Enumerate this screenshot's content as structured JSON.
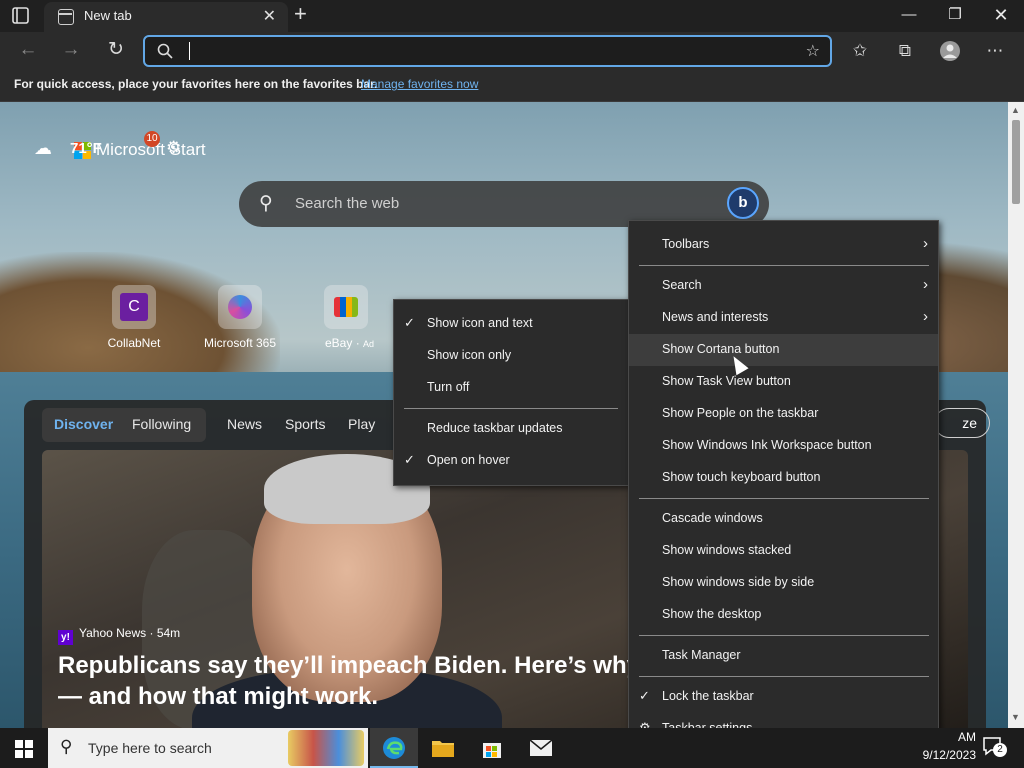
{
  "browser": {
    "tab_title": "New tab",
    "address_value": "",
    "favorites_message": "For quick access, place your favorites here on the favorites bar.",
    "favorites_link": "Manage favorites now"
  },
  "ntp": {
    "temperature": "71°F",
    "brand": "Microsoft Start",
    "notification_count": "10",
    "search_placeholder": "Search the web",
    "quick_links": [
      {
        "label": "CollabNet",
        "icon": "C"
      },
      {
        "label": "Microsoft 365",
        "icon": "m365-icon"
      },
      {
        "label": "eBay",
        "icon": "ebay-icon",
        "ad": "Ad"
      }
    ],
    "feed_tabs": [
      "Discover",
      "Following",
      "News",
      "Sports",
      "Play"
    ],
    "personalize_label": "ze",
    "article": {
      "source": "Yahoo News · 54m",
      "source_logo": "y!",
      "headline": "Republicans say they’ll impeach Biden. Here’s why — and how that might work."
    }
  },
  "taskbar_menu": {
    "items": [
      {
        "label": "Toolbars",
        "submenu": true
      },
      {
        "label": "Search",
        "submenu": true
      },
      {
        "label": "News and interests",
        "submenu": true
      },
      {
        "label": "Show Cortana button",
        "highlighted": true
      },
      {
        "label": "Show Task View button"
      },
      {
        "label": "Show People on the taskbar"
      },
      {
        "label": "Show Windows Ink Workspace button"
      },
      {
        "label": "Show touch keyboard button"
      },
      {
        "label": "Cascade windows"
      },
      {
        "label": "Show windows stacked"
      },
      {
        "label": "Show windows side by side"
      },
      {
        "label": "Show the desktop"
      },
      {
        "label": "Task Manager"
      },
      {
        "label": "Lock the taskbar",
        "checked": true
      },
      {
        "label": "Taskbar settings",
        "icon": "gear-icon"
      }
    ]
  },
  "news_submenu": {
    "items": [
      {
        "label": "Show icon and text",
        "checked": true
      },
      {
        "label": "Show icon only"
      },
      {
        "label": "Turn off"
      },
      {
        "label": "Reduce taskbar updates"
      },
      {
        "label": "Open on hover",
        "checked": true
      }
    ]
  },
  "taskbar": {
    "search_placeholder": "Type here to search",
    "time": "AM",
    "date": "9/12/2023",
    "notification_count": "2"
  },
  "colors": {
    "accent": "#62a7e6",
    "menu_bg": "#2b2b2b",
    "menu_hover": "#3d3d3d",
    "taskbar_bg": "#1c1c1c"
  }
}
